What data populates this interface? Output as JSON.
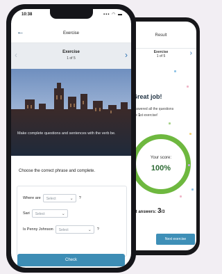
{
  "front": {
    "status_time": "10:38",
    "status_icons": "▪▪▪ ◠ ▬",
    "nav_back": "←",
    "nav_title": "Exercise",
    "exercise_title": "Exercise",
    "exercise_sub": "1 of 5",
    "prev": "‹",
    "next": "›",
    "caption": "Make complete questions and sentences with the verb be.",
    "instruction": "Choose the correct phrase and complete.",
    "rows": [
      {
        "label": "Where are",
        "select": "Select",
        "tail": "?"
      },
      {
        "label": "Sari",
        "select": "Select",
        "tail": ""
      },
      {
        "label": "Is Penny Johnson",
        "select": "Select",
        "tail": "?"
      }
    ],
    "check_label": "Check"
  },
  "back": {
    "header": "Result",
    "exercise_title": "Exercise",
    "exercise_sub": "1 of 5",
    "next": "›",
    "great": "Great job!",
    "answered_line1": "answered all the questions",
    "answered_line2_pre": "the",
    "answered_line2_num": "1",
    "answered_line2_post": "st exercise!",
    "score_label": "Your score:",
    "score_value": "100%",
    "correct_label": "ect answers:",
    "correct_num": "3",
    "correct_den": "/3",
    "next_exercise": "Next exercise"
  },
  "colors": {
    "accent": "#3d8db5",
    "ring": "#6eb83f",
    "score_text": "#2d6a34",
    "background": "#f2eef3"
  }
}
